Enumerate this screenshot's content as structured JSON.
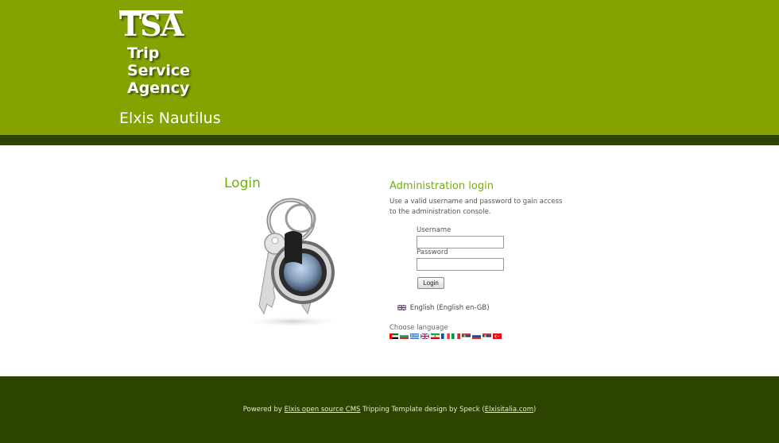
{
  "header": {
    "logo_abbr": "TSA",
    "logo_lines": [
      "Trip",
      "Service",
      "Agency"
    ],
    "site_name": "Elxis Nautilus"
  },
  "login": {
    "title": "Login"
  },
  "admin": {
    "title": "Administration login",
    "description": "Use a valid username and password to gain access to the administration console.",
    "username_label": "Username",
    "password_label": "Password",
    "username_value": "",
    "password_value": "",
    "login_button": "Login",
    "current_language": "English (English en-GB)",
    "choose_language": "Choose language",
    "flags": [
      "ae-flag",
      "bg-flag",
      "gr-flag",
      "gb-flag",
      "ir-flag",
      "fr-flag",
      "it-flag",
      "rs-flag",
      "ru-flag",
      "rs2-flag",
      "tr-flag"
    ]
  },
  "footer": {
    "prefix": "Powered by",
    "cms_link": "Elxis open source CMS",
    "middle": "Tripping Template design by Speck",
    "paren_open": "(",
    "site_link": "Elxisitalia.com",
    "paren_close": ")"
  },
  "colors": {
    "header": "#85a300",
    "dark_band": "#2d4300",
    "accent": "#6db300"
  }
}
